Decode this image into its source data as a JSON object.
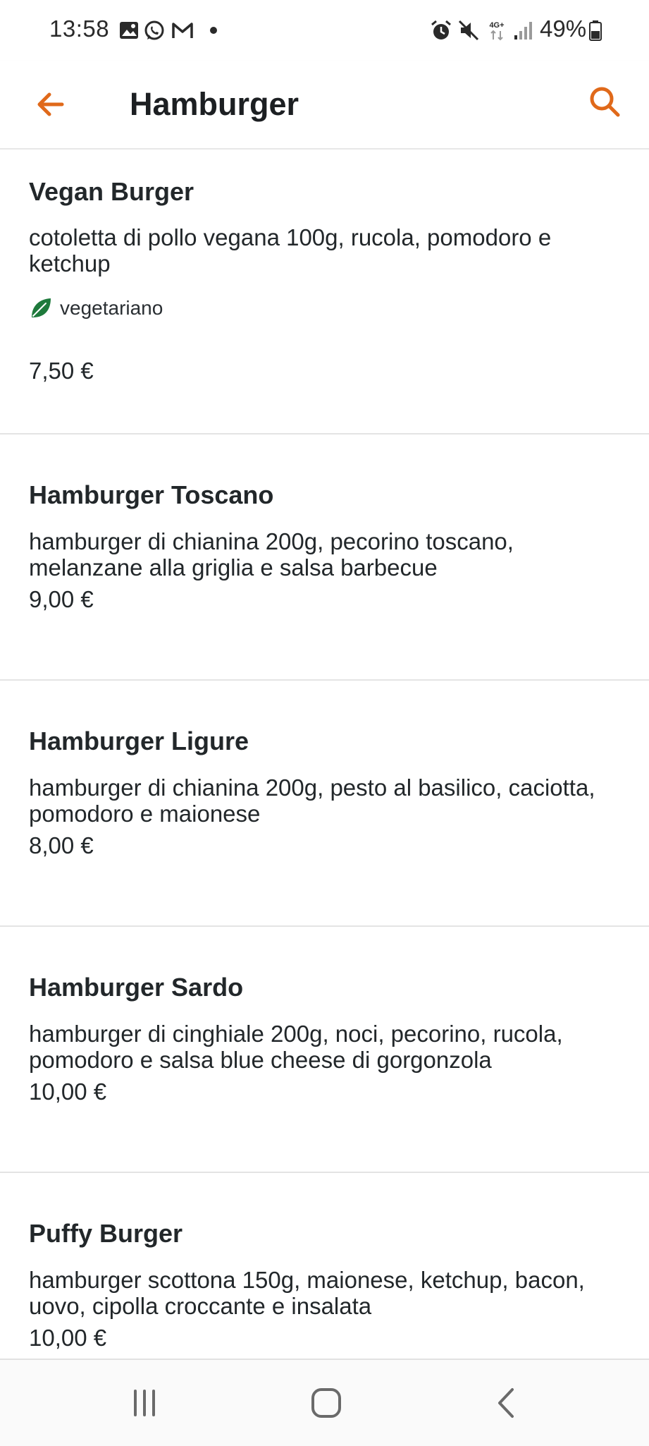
{
  "status_bar": {
    "time": "13:58",
    "battery": "49%",
    "network": "4G+",
    "icons": [
      "gallery-icon",
      "whatsapp-icon",
      "gmail-icon",
      "notification-dot-icon",
      "alarm-icon",
      "mute-icon",
      "signal-icon",
      "battery-icon"
    ]
  },
  "app_bar": {
    "title": "Hamburger",
    "back_icon": "arrow-left-icon",
    "search_icon": "search-icon"
  },
  "colors": {
    "accent": "#E0691A",
    "veg_leaf": "#1E7A3C",
    "divider": "#E4E4E4",
    "text": "#22272A"
  },
  "menu_items": [
    {
      "name": "Vegan Burger",
      "description": "cotoletta di pollo vegana 100g, rucola, pomodoro e ketchup",
      "tag": "vegetariano",
      "price": "7,50 €"
    },
    {
      "name": "Hamburger Toscano",
      "description": "hamburger di chianina 200g, pecorino toscano, melanzane alla griglia e salsa barbecue",
      "price": "9,00 €"
    },
    {
      "name": "Hamburger Ligure",
      "description": "hamburger di chianina 200g, pesto al basilico, caciotta, pomodoro e maionese",
      "price": "8,00 €"
    },
    {
      "name": "Hamburger Sardo",
      "description": "hamburger di cinghiale 200g, noci, pecorino, rucola, pomodoro e salsa blue cheese di gorgonzola",
      "price": "10,00 €"
    },
    {
      "name": "Puffy Burger",
      "description": "hamburger scottona 150g, maionese, ketchup, bacon, uovo, cipolla croccante e insalata",
      "price": "10,00 €"
    }
  ],
  "nav_bar": {
    "buttons": [
      "recent-apps-icon",
      "home-icon",
      "back-nav-icon"
    ]
  }
}
